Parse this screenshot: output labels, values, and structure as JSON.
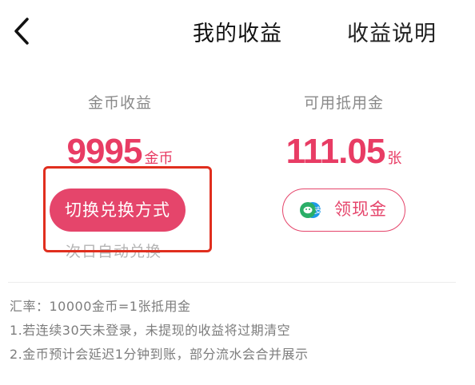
{
  "header": {
    "back_icon": "chevron-left-icon",
    "title": "我的收益",
    "explain_link": "收益说明"
  },
  "coin_earnings": {
    "label": "金币收益",
    "value": "9995",
    "unit": "金币",
    "switch_button": "切换兑换方式",
    "note": "次日自动兑换"
  },
  "voucher": {
    "label": "可用抵用金",
    "value": "111.05",
    "unit": "张",
    "collect_button": "领现金",
    "collect_icon": "wechat-pay-icon"
  },
  "notes": [
    "汇率：10000金币=1张抵用金",
    "1.若连续30天未登录，未提现的收益将过期清空",
    "2.金币预计会延迟1分钟到账，部分流水会合并展示"
  ],
  "colors": {
    "accent": "#e5456b",
    "highlight_border": "#e02e1e",
    "wechat_green": "#2aae67",
    "pay_blue": "#1e9ae8"
  }
}
